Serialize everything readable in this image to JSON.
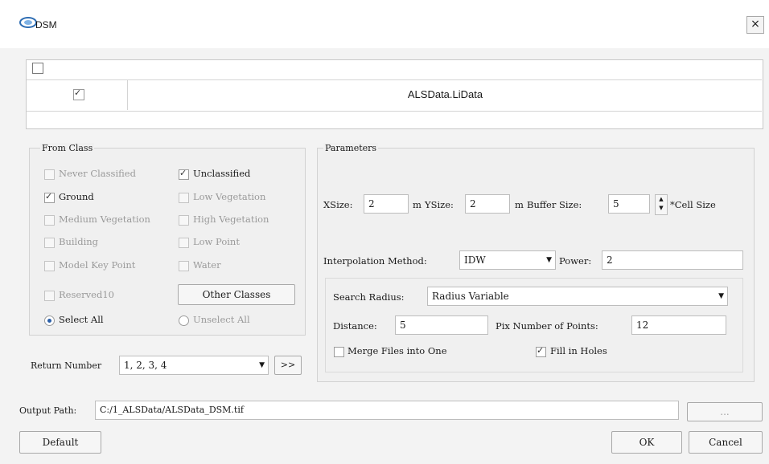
{
  "window": {
    "title": "DSM",
    "close_label": "×"
  },
  "file_table": {
    "rows": [
      {
        "checked": true,
        "file": "ALSData.LiData"
      }
    ]
  },
  "from_class": {
    "title": "From Class",
    "items": [
      {
        "label": "Never Classified",
        "checked": false,
        "enabled": false
      },
      {
        "label": "Unclassified",
        "checked": true,
        "enabled": true
      },
      {
        "label": "Ground",
        "checked": true,
        "enabled": true
      },
      {
        "label": "Low Vegetation",
        "checked": false,
        "enabled": false
      },
      {
        "label": "Medium Vegetation",
        "checked": false,
        "enabled": false
      },
      {
        "label": "High Vegetation",
        "checked": false,
        "enabled": false
      },
      {
        "label": "Building",
        "checked": false,
        "enabled": false
      },
      {
        "label": "Low Point",
        "checked": false,
        "enabled": false
      },
      {
        "label": "Model Key Point",
        "checked": false,
        "enabled": false
      },
      {
        "label": "Water",
        "checked": false,
        "enabled": false
      },
      {
        "label": "Reserved10",
        "checked": false,
        "enabled": false
      }
    ],
    "other_classes_label": "Other Classes",
    "select_all_label": "Select All",
    "unselect_all_label": "Unselect All",
    "selected": "Select All"
  },
  "return_number": {
    "label": "Return Number",
    "value": "1, 2, 3, 4",
    "more_label": ">>"
  },
  "parameters": {
    "title": "Parameters",
    "xsize_label": "XSize:",
    "xsize_value": "2",
    "xsize_unit": "m",
    "ysize_label": "YSize:",
    "ysize_value": "2",
    "ysize_unit": "m",
    "buffer_label": "Buffer Size:",
    "buffer_value": "5",
    "buffer_unit": "*Cell Size",
    "interp_label": "Interpolation Method:",
    "interp_value": "IDW",
    "power_label": "Power:",
    "power_value": "2",
    "search_radius_label": "Search Radius:",
    "search_radius_value": "Radius Variable",
    "distance_label": "Distance:",
    "distance_value": "5",
    "min_points_label": "Pix Number of Points:",
    "min_points_value": "12",
    "merge_label": "Merge Files into One",
    "merge_checked": false,
    "fill_label": "Fill in Holes",
    "fill_checked": true
  },
  "output": {
    "label": "Output Path:",
    "value": "C:/1_ALSData/ALSData_DSM.tif",
    "browse_label": "..."
  },
  "footer": {
    "default_label": "Default",
    "ok_label": "OK",
    "cancel_label": "Cancel"
  },
  "colors": {
    "dialog_bg": "#f3f3f3",
    "border": "#c8c8c8",
    "radio_accent": "#2a5fa8"
  }
}
